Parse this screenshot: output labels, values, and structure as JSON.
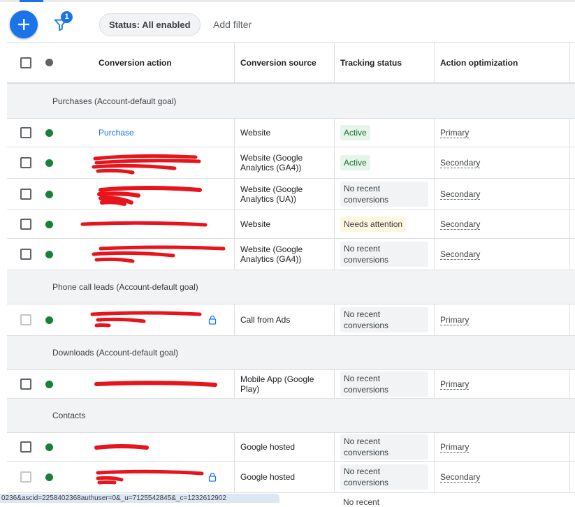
{
  "toolbar": {
    "filter_count": "1",
    "status_chip": "Status: All enabled",
    "add_filter": "Add filter"
  },
  "table": {
    "headers": {
      "conversion_action": "Conversion action",
      "conversion_source": "Conversion source",
      "tracking_status": "Tracking status",
      "action_optimization": "Action optimization"
    },
    "groups": [
      {
        "label": "Purchases (Account-default goal)",
        "rows": [
          {
            "name": "Purchase",
            "source": "Website",
            "status": "Active",
            "optimization": "Primary"
          },
          {
            "name": "",
            "source": "Website (Google Analytics (GA4))",
            "status": "Active",
            "optimization": "Secondary"
          },
          {
            "name": "",
            "source": "Website (Google Analytics (UA))",
            "status": "No recent conversions",
            "optimization": "Secondary"
          },
          {
            "name": "",
            "source": "Website",
            "status": "Needs attention",
            "optimization": "Secondary"
          },
          {
            "name": "",
            "source": "Website (Google Analytics (GA4))",
            "status": "No recent conversions",
            "optimization": "Secondary"
          }
        ]
      },
      {
        "label": "Phone call leads (Account-default goal)",
        "rows": [
          {
            "name": "",
            "source": "Call from Ads",
            "status": "No recent conversions",
            "optimization": "Primary"
          }
        ]
      },
      {
        "label": "Downloads (Account-default goal)",
        "rows": [
          {
            "name": "",
            "source": "Mobile App (Google Play)",
            "status": "No recent conversions",
            "optimization": "Primary"
          }
        ]
      },
      {
        "label": "Contacts",
        "rows": [
          {
            "name": "",
            "source": "Google hosted",
            "status": "No recent conversions",
            "optimization": "Primary"
          },
          {
            "name": "",
            "source": "Google hosted",
            "status": "No recent conversions",
            "optimization": "Secondary"
          }
        ]
      }
    ],
    "partial_row_status": "No recent"
  },
  "status_bar_url": "0236&ascid=2258402368authuser=0&_u=7125542845&_c=1232612902",
  "colors": {
    "accent": "#1a73e8",
    "enabled_dot": "#188038",
    "redaction": "#e8131b"
  },
  "icons": {
    "create": "plus-icon",
    "filter": "funnel-icon",
    "locked": "lock-icon"
  }
}
